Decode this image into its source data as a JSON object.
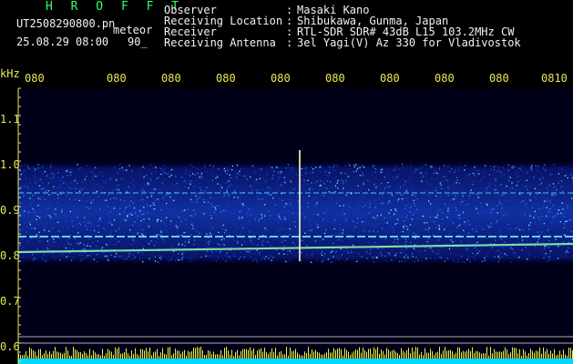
{
  "header": {
    "app_title": "H R O F F T",
    "file_name": "UT2508290800.pn",
    "meteor_label": "meteor",
    "datetime": "25.08.29 08:00",
    "count": "90_"
  },
  "info": [
    {
      "label": "Observer",
      "sep": ":",
      "value": "Masaki Kano"
    },
    {
      "label": "Receiving Location",
      "sep": ":",
      "value": "Shibukawa, Gunma, Japan"
    },
    {
      "label": "Receiver",
      "sep": ":",
      "value": "RTL-SDR SDR# 43dB L15 103.2MHz CW"
    },
    {
      "label": "Receiving Antenna",
      "sep": ":",
      "value": "3el Yagi(V) Az 330 for Vladivostok"
    }
  ],
  "axis": {
    "unit": "kHz",
    "time_ticks": [
      "080",
      "080",
      "080",
      "080",
      "080",
      "080",
      "080",
      "080",
      "080",
      "0810"
    ],
    "freq_ticks": [
      "1.1",
      "1.0",
      "0.9",
      "0.8",
      "0.7",
      "0.6"
    ]
  },
  "colors": {
    "background": "#000000",
    "text": "#f2f2f2",
    "title": "#33ff66",
    "axis": "#e8e85a",
    "noise_band": "#1e46ff",
    "signal": "#6cf0ff",
    "meteor": "#ffffc0"
  }
}
